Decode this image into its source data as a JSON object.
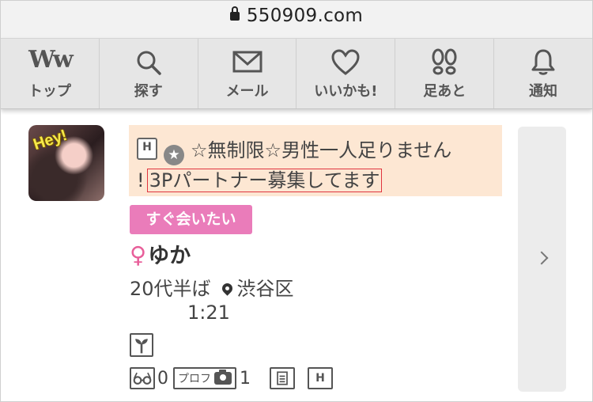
{
  "browser": {
    "url": "550909.com"
  },
  "nav": {
    "items": [
      {
        "label": "トップ",
        "icon": "ww-logo-icon",
        "logo_text": "Ww"
      },
      {
        "label": "探す",
        "icon": "search-icon"
      },
      {
        "label": "メール",
        "icon": "mail-icon"
      },
      {
        "label": "いいかも!",
        "icon": "heart-icon"
      },
      {
        "label": "足あと",
        "icon": "footprints-icon"
      },
      {
        "label": "通知",
        "icon": "bell-icon"
      }
    ]
  },
  "post": {
    "avatar_text": "Hey!",
    "badge_h": "H",
    "badge_star": "★",
    "message_line1": "☆無制限☆男性一人足りません",
    "message_line2_prefix": "!",
    "message_highlight": "3Pパートナー募集してます",
    "tag": "すぐ会いたい",
    "gender_symbol": "♀",
    "name": "ゆか",
    "age": "20代半ば",
    "location": "渋谷区",
    "time": "1:21",
    "stats": {
      "views_count": "0",
      "prof_label": "プロフ",
      "photo_count": "1",
      "badge_h": "H"
    }
  },
  "colors": {
    "accent_pink": "#ea7cba",
    "message_bg": "#fde7d3",
    "highlight_border": "#e0353f"
  }
}
